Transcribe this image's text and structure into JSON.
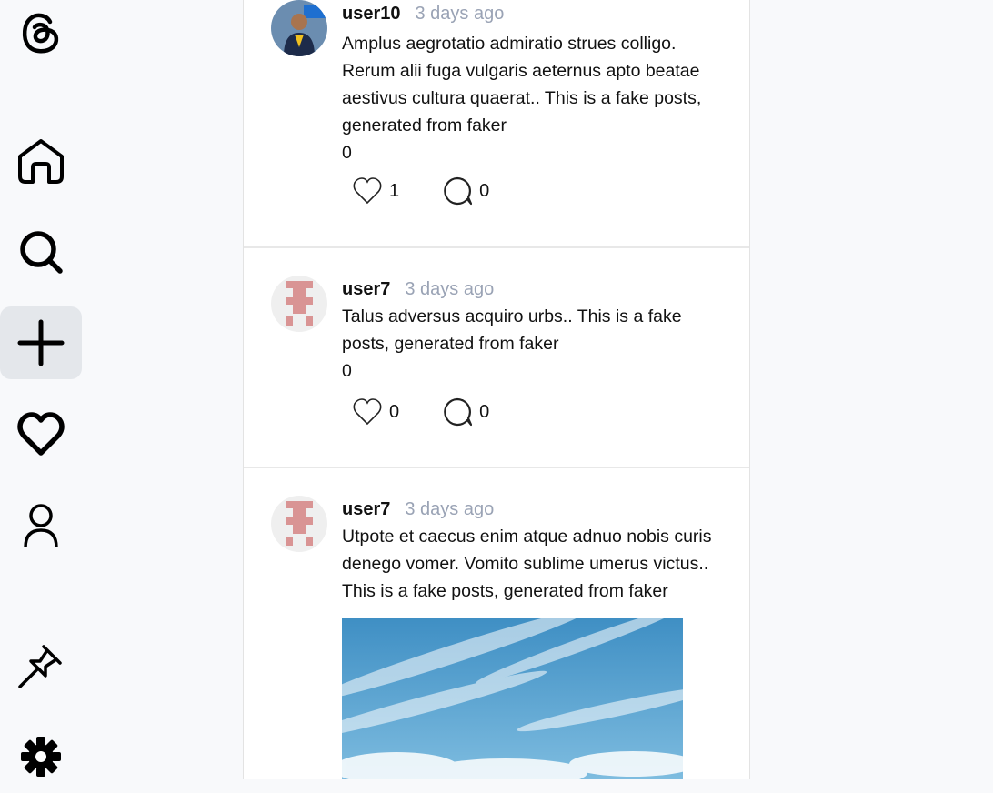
{
  "sidebar": {
    "logo": "threads-logo-icon",
    "items": [
      {
        "name": "home",
        "icon": "home-icon"
      },
      {
        "name": "search",
        "icon": "search-icon"
      },
      {
        "name": "create",
        "icon": "plus-icon",
        "active": true
      },
      {
        "name": "activity",
        "icon": "heart-icon"
      },
      {
        "name": "profile",
        "icon": "user-icon"
      },
      {
        "name": "pinned",
        "icon": "pin-icon"
      },
      {
        "name": "settings",
        "icon": "gear-icon"
      }
    ]
  },
  "posts": [
    {
      "username": "user10",
      "time": "3 days ago",
      "text": "Amplus aegrotatio admiratio strues colligo. Rerum alii fuga vulgaris aeternus apto beatae aestivus cultura quaerat.. This is a fake posts, generated from faker",
      "extra": "0",
      "likes": "1",
      "comments": "0"
    },
    {
      "username": "user7",
      "time": "3 days ago",
      "text": "Talus adversus acquiro urbs.. This is a fake posts, generated from faker",
      "extra": "0",
      "likes": "0",
      "comments": "0"
    },
    {
      "username": "user7",
      "time": "3 days ago",
      "text": "Utpote et caecus enim atque adnuo nobis curis denego vomer. Vomito sublime umerus victus.. This is a fake posts, generated from faker"
    }
  ],
  "colors": {
    "active_nav_bg": "#e4e7eb",
    "timestamp": "#9aa3b5",
    "identicon": "#d99494"
  }
}
